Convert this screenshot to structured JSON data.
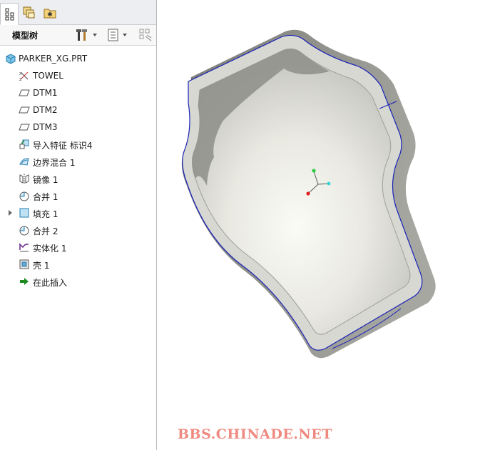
{
  "tabs": [
    {
      "name": "model-tree",
      "icon": "model-tree-icon"
    },
    {
      "name": "layers",
      "icon": "layers-icon"
    },
    {
      "name": "favorites",
      "icon": "favorites-folder-icon"
    }
  ],
  "tree": {
    "title": "模型树",
    "tools": [
      "settings-tools-icon",
      "show-list-icon",
      "filter-icon"
    ],
    "root": {
      "label": "PARKER_XG.PRT",
      "icon": "part-icon"
    },
    "items": [
      {
        "label": "TOWEL",
        "icon": "coordinate-system-icon",
        "expandable": false
      },
      {
        "label": "DTM1",
        "icon": "datum-plane-icon",
        "expandable": false
      },
      {
        "label": "DTM2",
        "icon": "datum-plane-icon",
        "expandable": false
      },
      {
        "label": "DTM3",
        "icon": "datum-plane-icon",
        "expandable": false
      },
      {
        "label": "导入特征 标识4",
        "icon": "import-feature-icon",
        "expandable": false
      },
      {
        "label": "边界混合 1",
        "icon": "boundary-blend-icon",
        "expandable": false
      },
      {
        "label": "镜像 1",
        "icon": "mirror-icon",
        "expandable": false
      },
      {
        "label": "合并 1",
        "icon": "merge-icon",
        "expandable": false
      },
      {
        "label": "填充 1",
        "icon": "fill-icon",
        "expandable": true
      },
      {
        "label": "合并 2",
        "icon": "merge-icon",
        "expandable": false
      },
      {
        "label": "实体化 1",
        "icon": "solidify-icon",
        "expandable": false
      },
      {
        "label": "壳 1",
        "icon": "shell-icon",
        "expandable": false
      },
      {
        "label": "在此插入",
        "icon": "insert-here-arrow-icon",
        "expandable": false
      }
    ]
  },
  "watermark": "BBS.CHINADE.NET",
  "colors": {
    "edge": "#1a23b8",
    "surface": "#e6e6df",
    "wall": "#8f908a",
    "watermark": "#ef8a80"
  }
}
